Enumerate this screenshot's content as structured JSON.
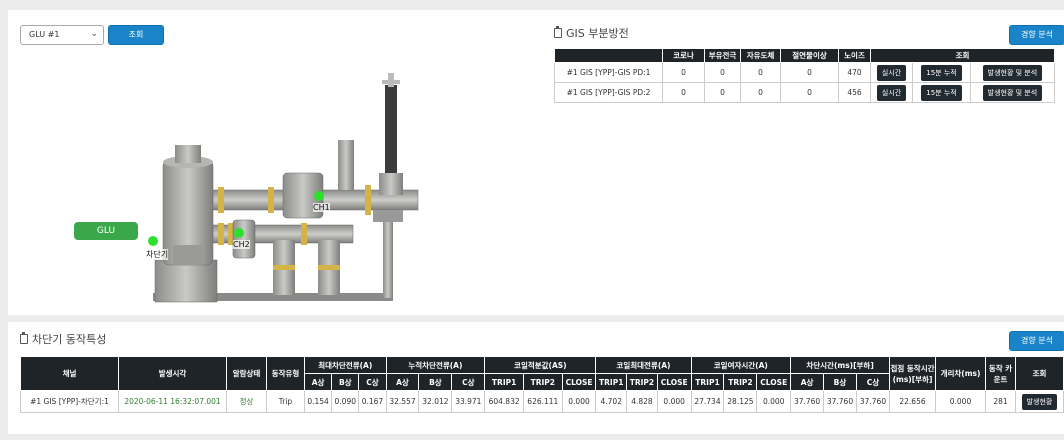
{
  "top": {
    "select_value": "GLU #1",
    "query_label": "조회",
    "trend_label": "경향 분석",
    "gis_title": "GIS 부분방전",
    "diagram": {
      "glu_label": "GLU",
      "ch1_label": "CH1",
      "ch2_label": "CH2",
      "breaker_label": "차단기"
    },
    "gis_table": {
      "headers": [
        "",
        "코로나",
        "부유전극",
        "자유도체",
        "절연물이상",
        "노이즈",
        "조회"
      ],
      "rows": [
        {
          "name": "#1 GIS [YPP]-GIS PD:1",
          "values": [
            "0",
            "0",
            "0",
            "0",
            "470"
          ],
          "btn1": "실시간",
          "btn2": "15분 누적",
          "btn3": "발생현황 및 분석"
        },
        {
          "name": "#1 GIS [YPP]-GIS PD:2",
          "values": [
            "0",
            "0",
            "0",
            "0",
            "456"
          ],
          "btn1": "실시간",
          "btn2": "15분 누적",
          "btn3": "발생현황 및 분석"
        }
      ]
    }
  },
  "bottom": {
    "title": "차단기 동작특성",
    "trend_label": "경향 분석",
    "headers_top": [
      "채널",
      "발생시각",
      "알람상태",
      "동작유형",
      "최대차단전류(A)",
      "누적차단전류(A)",
      "코일적분값(AS)",
      "코일최대전류(A)",
      "코일여자시간(A)",
      "차단시간(ms)[부하]",
      "접점 동작시간 (ms)[부하]",
      "개리차(ms)",
      "동작 카운트",
      "조회"
    ],
    "headers_sub": [
      "A상",
      "B상",
      "C상",
      "A상",
      "B상",
      "C상",
      "TRIP1",
      "TRIP2",
      "CLOSE",
      "TRIP1",
      "TRIP2",
      "CLOSE",
      "TRIP1",
      "TRIP2",
      "CLOSE",
      "A상",
      "B상",
      "C상"
    ],
    "row": {
      "channel": "#1 GIS [YPP]-차단기:1",
      "time": "2020-06-11 16:32:07.001",
      "alarm": "정상",
      "type": "Trip",
      "values": [
        "0.154",
        "0.090",
        "0.167",
        "32.557",
        "32.012",
        "33.971",
        "604.832",
        "626.111",
        "0.000",
        "4.702",
        "4.828",
        "0.000",
        "27.734",
        "28.125",
        "0.000",
        "37.760",
        "37.760",
        "37.760"
      ],
      "contact_time": "22.656",
      "diff": "0.000",
      "count": "281",
      "btn": "발생현황"
    }
  }
}
